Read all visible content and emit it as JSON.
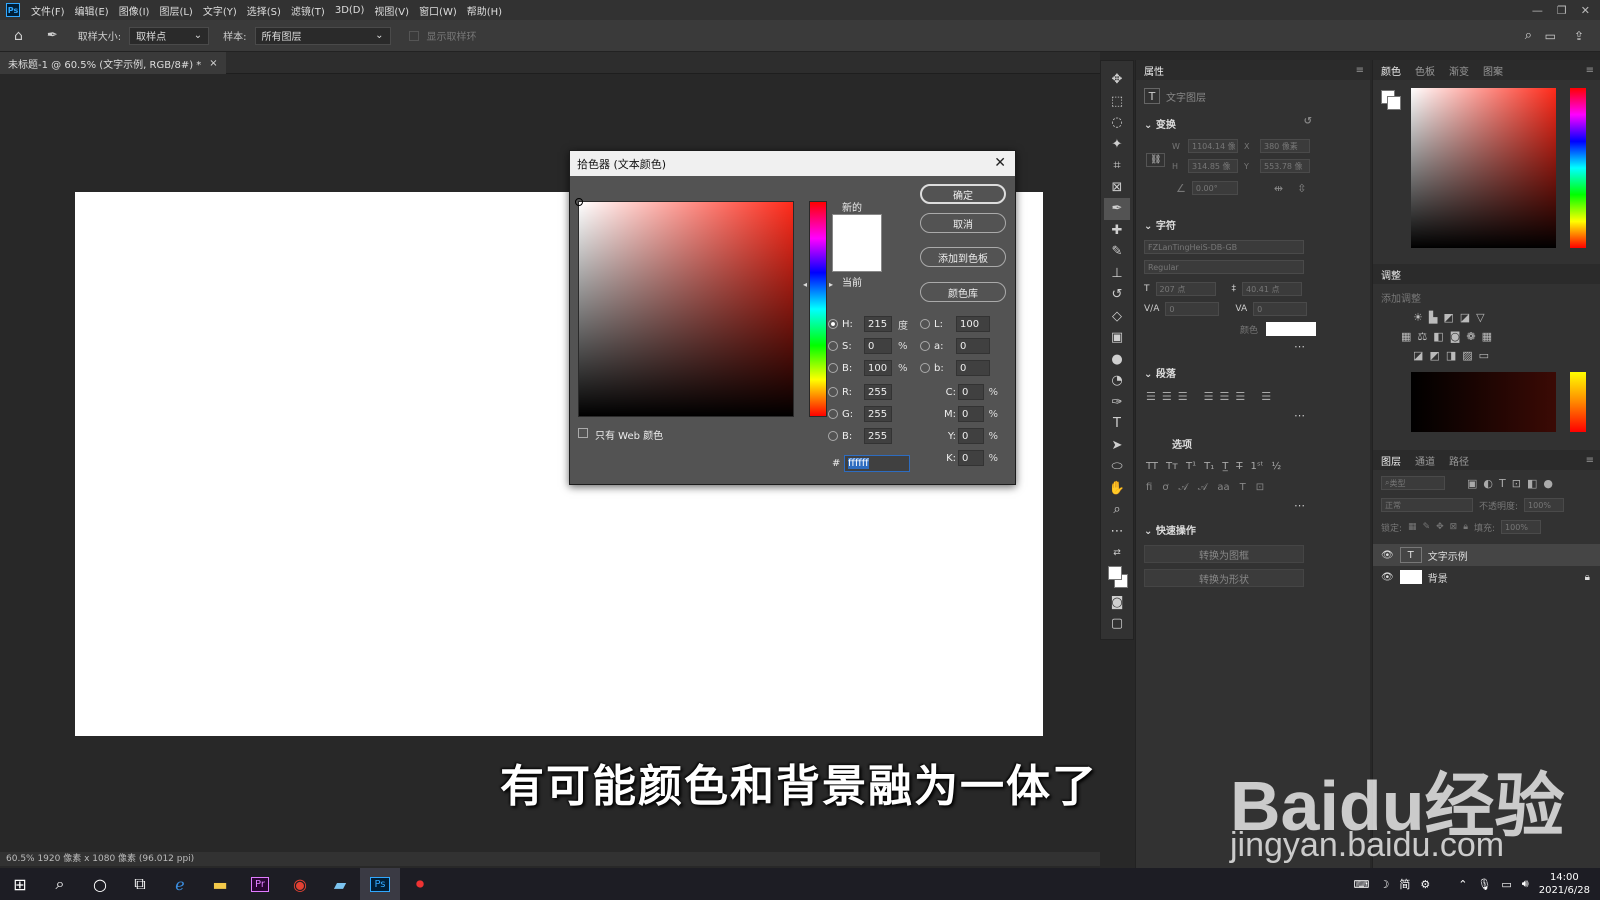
{
  "menubar": {
    "app_icon": "Ps",
    "items": [
      "文件(F)",
      "编辑(E)",
      "图像(I)",
      "图层(L)",
      "文字(Y)",
      "选择(S)",
      "滤镜(T)",
      "3D(D)",
      "视图(V)",
      "窗口(W)",
      "帮助(H)"
    ]
  },
  "options": {
    "sample_size_label": "取样大小:",
    "sample_size_value": "取样点",
    "sample_label": "样本:",
    "sample_value": "所有图层",
    "show_ring": "显示取样环"
  },
  "document": {
    "tab_title": "未标题-1 @ 60.5% (文字示例, RGB/8#) *",
    "status": "60.5%  1920 像素 x 1080 像素 (96.012 ppi)"
  },
  "properties": {
    "tabs": [
      "属性"
    ],
    "layer_kind": "文字图层",
    "transform_title": "变换",
    "w_value": "1104.14 像",
    "x_value": "380 像素",
    "h_value": "314.85 像",
    "y_value": "553.78 像",
    "angle_value": "0.00°",
    "char_title": "字符",
    "font_family": "FZLanTingHeiS-DB-GB",
    "font_style": "Regular",
    "font_size": "207 点",
    "leading": "40.41 点",
    "kerning": "0",
    "tracking": "0",
    "color_label": "颜色",
    "para_title": "段落",
    "type_options_title": "选项",
    "quick_title": "快速操作",
    "convert_frame": "转换为图框",
    "convert_shape": "转换为形状"
  },
  "right_panel": {
    "color_tabs": [
      "颜色",
      "色板",
      "渐变",
      "图案"
    ],
    "adjust_tab": "调整",
    "add_adjust": "添加调整",
    "layer_tabs": [
      "图层",
      "通道",
      "路径"
    ],
    "search_placeholder": "类型",
    "blend_mode": "正常",
    "opacity_label": "不透明度:",
    "opacity_value": "100%",
    "lock_label": "锁定:",
    "fill_label": "填充:",
    "fill_value": "100%",
    "layers": [
      {
        "name": "文字示例",
        "type": "T"
      },
      {
        "name": "背景",
        "type": ""
      }
    ]
  },
  "dialog": {
    "title": "拾色器 (文本颜色)",
    "new_label": "新的",
    "current_label": "当前",
    "ok": "确定",
    "cancel": "取消",
    "add_swatch": "添加到色板",
    "color_lib": "颜色库",
    "web_only": "只有 Web 颜色",
    "h": "215",
    "h_unit": "度",
    "s": "0",
    "s_unit": "%",
    "b": "100",
    "b_unit": "%",
    "r": "255",
    "g": "255",
    "bb": "255",
    "l": "100",
    "a": "0",
    "b2": "0",
    "c": "0",
    "m": "0",
    "y": "0",
    "k": "0",
    "hex": "ffffff"
  },
  "subtitle": "有可能颜色和背景融为一体了",
  "watermark": {
    "line1": "Baidu经验",
    "line2": "jingyan.baidu.com"
  },
  "taskbar": {
    "time": "14:00",
    "date": "2021/6/28",
    "ime": "简"
  },
  "colors": {
    "accent": "#31a8ff",
    "dialog_bg": "#535353",
    "panel_bg": "#323232"
  }
}
